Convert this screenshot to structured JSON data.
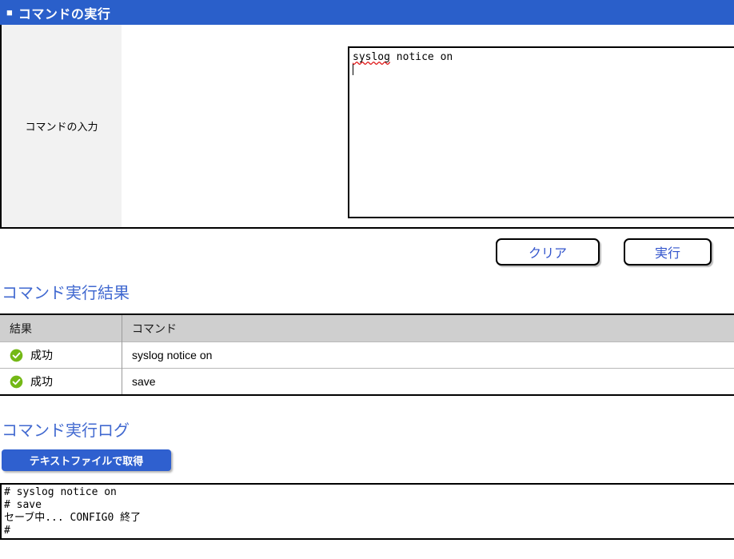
{
  "titlebar": {
    "bullet": "■",
    "title": "コマンドの実行"
  },
  "form": {
    "label": "コマンドの入力",
    "textarea": {
      "value": "syslog notice on",
      "misspelled_word": "syslog",
      "rest_of_line": " notice on"
    }
  },
  "actions": {
    "clear_label": "クリア",
    "execute_label": "実行"
  },
  "results": {
    "heading": "コマンド実行結果",
    "columns": [
      "結果",
      "コマンド"
    ],
    "rows": [
      {
        "status": "成功",
        "status_icon": "check-circle-icon",
        "command": "syslog notice on"
      },
      {
        "status": "成功",
        "status_icon": "check-circle-icon",
        "command": "save"
      }
    ]
  },
  "log": {
    "heading": "コマンド実行ログ",
    "download_label": "テキストファイルで取得",
    "content": "# syslog notice on\n# save\nセーブ中... CONFIG0 終了\n#"
  },
  "colors": {
    "title_bar_blue": "#2a5fca",
    "heading_blue": "#4169d0",
    "button_text_blue": "#3355cc",
    "download_button_blue": "#2f60cf",
    "table_header_gray": "#cfcfcf",
    "panel_gray": "#f2f2f2",
    "success_green": "#74b816"
  }
}
